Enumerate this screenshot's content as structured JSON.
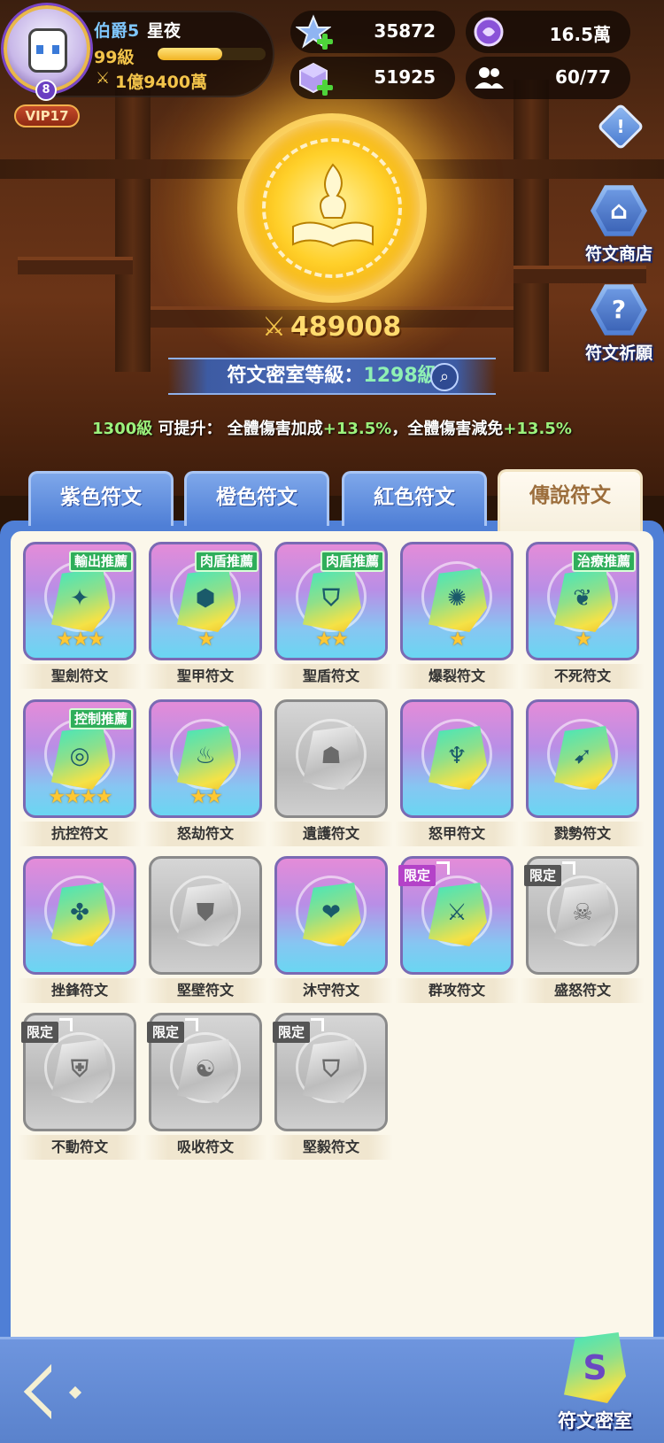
{
  "player": {
    "rank": "伯爵5",
    "name": "星夜",
    "level": "99級",
    "power": "1億9400萬",
    "avatar_badge": "8",
    "vip": "VIP17",
    "exp_fraction": 0.6
  },
  "resources": {
    "stars": "35872",
    "crystals": "51925",
    "orbs": "16.5萬",
    "team": "60/77"
  },
  "side_buttons": {
    "info_glyph": "!",
    "shop_label": "符文商店",
    "wish_label": "符文祈願"
  },
  "room": {
    "total_power": "489008",
    "level_label": "符文密室等級：",
    "level_value": "1298級",
    "hint_level": "1300級",
    "hint_text1": " 可提升： 全體傷害加成",
    "hint_bonus1": "+13.5%",
    "hint_text2": "，全體傷害減免",
    "hint_bonus2": "+13.5%"
  },
  "tabs": [
    "紫色符文",
    "橙色符文",
    "紅色符文",
    "傳說符文"
  ],
  "runes": [
    {
      "name": "聖劍符文",
      "tag": "輸出推薦",
      "stars": "★★★",
      "glyph": "✦"
    },
    {
      "name": "聖甲符文",
      "tag": "肉盾推薦",
      "stars": "★",
      "glyph": "⬢"
    },
    {
      "name": "聖盾符文",
      "tag": "肉盾推薦",
      "stars": "★★",
      "glyph": "⛉"
    },
    {
      "name": "爆裂符文",
      "tag": "",
      "stars": "★",
      "glyph": "✺"
    },
    {
      "name": "不死符文",
      "tag": "治療推薦",
      "stars": "★",
      "glyph": "❦"
    },
    {
      "name": "抗控符文",
      "tag": "控制推薦",
      "stars": "★★★★",
      "glyph": "◎"
    },
    {
      "name": "怒劫符文",
      "tag": "",
      "stars": "★★",
      "glyph": "♨"
    },
    {
      "name": "遺護符文",
      "tag": "",
      "stars": "",
      "glyph": "☗"
    },
    {
      "name": "怒甲符文",
      "tag": "",
      "stars": "",
      "glyph": "♆"
    },
    {
      "name": "戮勢符文",
      "tag": "",
      "stars": "",
      "glyph": "➹"
    },
    {
      "name": "挫鋒符文",
      "tag": "",
      "stars": "",
      "glyph": "✤"
    },
    {
      "name": "堅壁符文",
      "tag": "",
      "stars": "",
      "glyph": "⛊"
    },
    {
      "name": "沐守符文",
      "tag": "",
      "stars": "",
      "glyph": "❤"
    },
    {
      "name": "群攻符文",
      "tag": "",
      "limited": "限定",
      "stars": "",
      "glyph": "⚔"
    },
    {
      "name": "盛怒符文",
      "tag": "",
      "limited": "限定",
      "stars": "",
      "glyph": "☠"
    },
    {
      "name": "不動符文",
      "tag": "",
      "limited": "限定",
      "stars": "",
      "glyph": "⛨"
    },
    {
      "name": "吸收符文",
      "tag": "",
      "limited": "限定",
      "stars": "",
      "glyph": "☯"
    },
    {
      "name": "堅毅符文",
      "tag": "",
      "limited": "限定",
      "stars": "",
      "glyph": "⛉"
    }
  ],
  "bottom": {
    "rune_room_label": "符文密室"
  },
  "icons": {
    "star_resource": "star-crystal-icon",
    "crystal_resource": "cube-crystal-icon",
    "orb_resource": "purple-orb-icon",
    "team_resource": "people-icon",
    "shop": "shop-icon",
    "wish": "question-hex-icon",
    "search": "magnifier-icon",
    "sword": "crossed-swords-icon"
  },
  "colors": {
    "tab_blue": "#5b86d8",
    "panel_cream": "#fbf7ea",
    "recommend_green": "#2fae5a",
    "limited_purple": "#b442c8",
    "limited_grey": "#555555",
    "gold": "#f3c44a"
  }
}
